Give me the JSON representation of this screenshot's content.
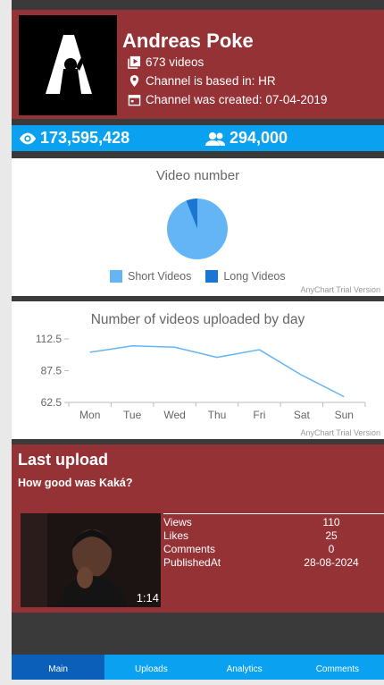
{
  "channel": {
    "name": "Andreas Poke",
    "videos": "673 videos",
    "country": "Channel is based in: HR",
    "created": "Channel was created: 07-04-2019"
  },
  "stats": {
    "views": "173,595,428",
    "subscribers": "294,000"
  },
  "pie_chart": {
    "title": "Video number",
    "legend": [
      "Short Videos",
      "Long Videos"
    ],
    "watermark": "AnyChart Trial Version"
  },
  "line_chart": {
    "title": "Number of videos uploaded by day",
    "watermark": "AnyChart Trial Version"
  },
  "chart_data": [
    {
      "type": "pie",
      "title": "Video number",
      "categories": [
        "Short Videos",
        "Long Videos"
      ],
      "values": [
        94,
        6
      ],
      "colors": [
        "#64b5f6",
        "#1976d2"
      ],
      "legend": "bottom"
    },
    {
      "type": "line",
      "title": "Number of videos uploaded by day",
      "categories": [
        "Mon",
        "Tue",
        "Wed",
        "Thu",
        "Fri",
        "Sat",
        "Sun"
      ],
      "series": [
        {
          "values": [
            102,
            107,
            106,
            98,
            104,
            84,
            67
          ]
        }
      ],
      "yticks": [
        "112.5",
        "87.5",
        "62.5"
      ],
      "ylim": [
        62.5,
        112.5
      ],
      "color": "#64b5f6"
    }
  ],
  "last_upload": {
    "heading": "Last upload",
    "title": "How good was Kaká?",
    "duration": "1:14",
    "rows": [
      {
        "label": "Views",
        "value": "110"
      },
      {
        "label": "Likes",
        "value": "25"
      },
      {
        "label": "Comments",
        "value": "0"
      },
      {
        "label": "PublishedAt",
        "value": "28-08-2024"
      }
    ]
  },
  "nav": [
    "Main",
    "Uploads",
    "Analytics",
    "Comments"
  ],
  "colors": {
    "header": "#953236",
    "accent": "#0aa1f0",
    "nav_active": "#0b5fb8"
  }
}
